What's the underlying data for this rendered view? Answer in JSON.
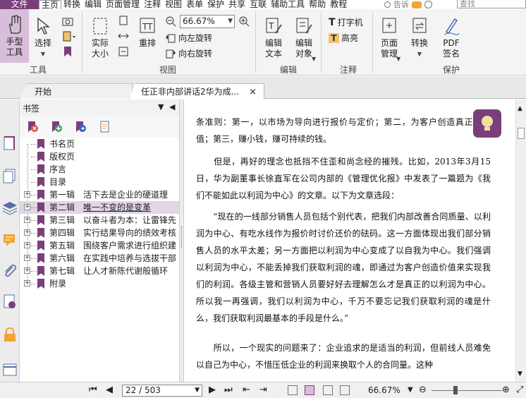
{
  "menubar": {
    "file": "文件",
    "items": [
      "主页",
      "转换",
      "编辑",
      "页面管理",
      "注释",
      "视图",
      "表单",
      "保护",
      "共享",
      "互联",
      "辅助工具",
      "帮助",
      "教程"
    ],
    "active_index": 0,
    "help_text": "告诉",
    "search_placeholder": "查找"
  },
  "ribbon": {
    "hand_tool": "手型\n工具",
    "select": "选择",
    "actual_size": "实际\n大小",
    "reflow": "重排",
    "zoom_value": "66.67%",
    "rotate_left": "向左旋转",
    "rotate_right": "向右旋转",
    "edit_text": "编辑\n文本",
    "edit_object": "编辑\n对象",
    "typewriter": "打字机",
    "highlight": "高亮",
    "page_manage": "页面\n管理",
    "convert": "转换",
    "pdf_sign": "PDF\n签名",
    "groups": {
      "tools": "工具",
      "view": "视图",
      "edit": "编辑",
      "comment": "注释",
      "protect": "保护"
    }
  },
  "tabs": {
    "start": "开始",
    "doc": "任正非内部讲话2华为成...",
    "close_symbol": "×"
  },
  "bookmarks": {
    "title": "书签",
    "items": [
      {
        "label": "书名页",
        "title": "",
        "expandable": false
      },
      {
        "label": "版权页",
        "title": "",
        "expandable": false
      },
      {
        "label": "序言",
        "title": "",
        "expandable": false
      },
      {
        "label": "目录",
        "title": "",
        "expandable": false
      },
      {
        "label": "第一辑",
        "title": "活下去是企业的硬道理",
        "expandable": true
      },
      {
        "label": "第二辑",
        "title": "唯一不变的是变革",
        "expandable": true,
        "selected": true
      },
      {
        "label": "第三辑",
        "title": "以奋斗者为本：让雷锋先",
        "expandable": true
      },
      {
        "label": "第四辑",
        "title": "实行结果导向的绩效考核",
        "expandable": true
      },
      {
        "label": "第五辑",
        "title": "围绕客户需求进行组织建",
        "expandable": true
      },
      {
        "label": "第六辑",
        "title": "在实践中培养与选拔干部",
        "expandable": true
      },
      {
        "label": "第七辑",
        "title": "让人才新陈代谢般循环",
        "expandable": true
      },
      {
        "label": "附录",
        "title": "",
        "expandable": true
      }
    ]
  },
  "document": {
    "paragraphs": [
      "条准则：第一，以市场为导向进行报价与定价；第二，为客户创造真正的价值；第三，赚小钱，赚可持续的钱。",
      "　　但是，再好的理念也抵挡不住歪和尚念经的摧残。比如，2013年3月15日，华为副董事长徐直军在公司内部的《管理优化报》中发表了一篇题为《我们不能如此以利润为中心》的文章。以下为文章选段：",
      "　　“现在的一线部分销售人员包括个别代表，把我们内部改善合同质量、以利润为中心、有吃水线作为报价时讨价还价的砝码。这一方面体现出我们部分销售人员的水平太差；另一方面把以利润为中心变成了以自我为中心。我们强调以利润为中心，不能丢掉我们获取利润的魂，即通过为客户创造价值来实现我们的利润。各级主管和营销人员要好好去理解怎么才是真正的以利润为中心。所以我一再强调，我们以利润为中心，千万不要忘记我们获取利润的魂是什么，我们获取利润最基本的手段是什么。”",
      "　　所以，一个现实的问题来了：企业追求的是适当的利润，但前线人员难免以自己为中心，不惜压低企业的利润来换取个人的合同量。这种"
    ]
  },
  "statusbar": {
    "page_value": "22 / 503",
    "zoom": "66.67%"
  },
  "colors": {
    "accent": "#7a3f7a",
    "accent_light": "#d9bedc"
  }
}
